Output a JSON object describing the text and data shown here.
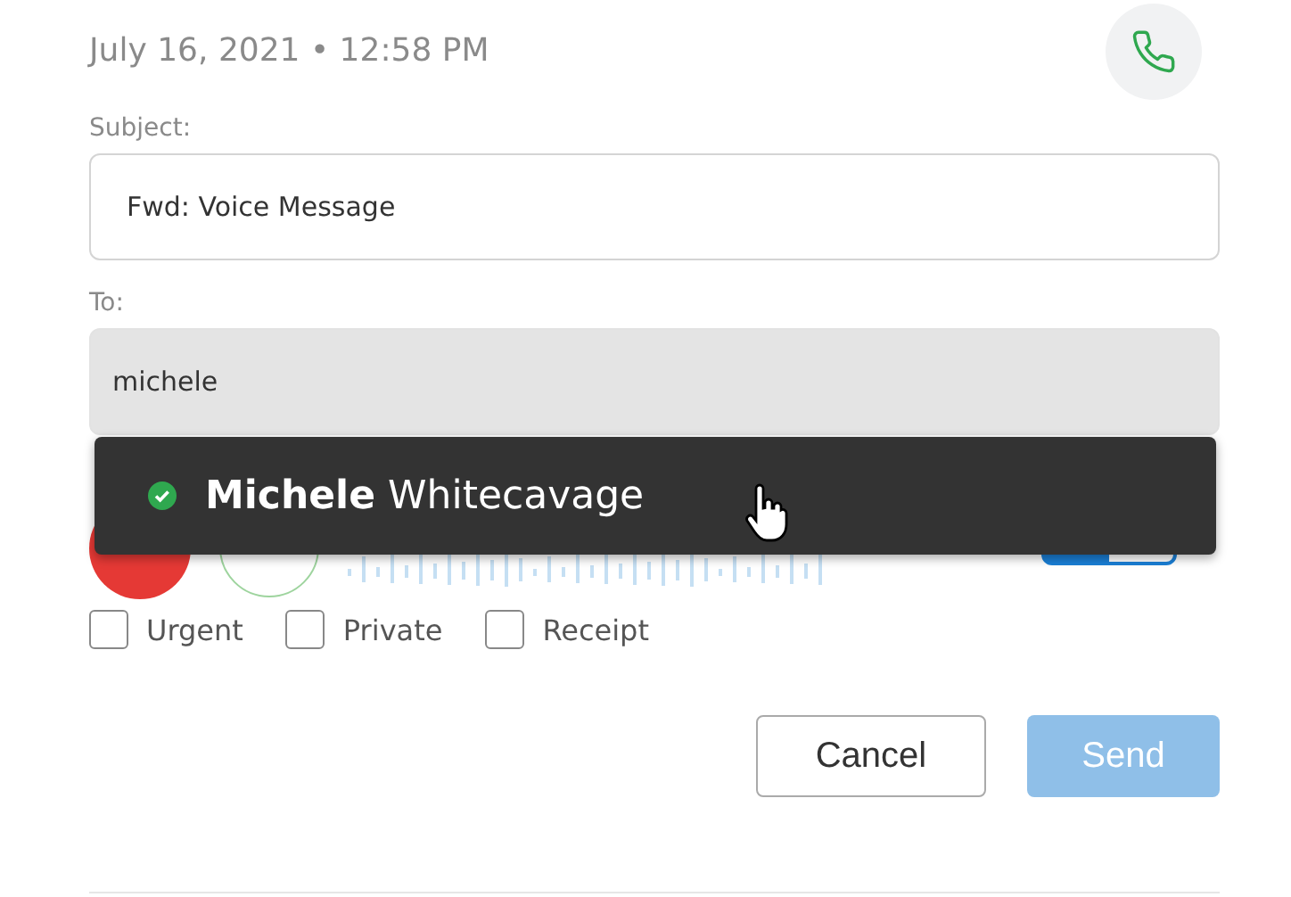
{
  "header": {
    "timestamp": "July 16, 2021 • 12:58 PM"
  },
  "subject": {
    "label": "Subject:",
    "value": "Fwd: Voice Message"
  },
  "to": {
    "label": "To:",
    "value": "michele"
  },
  "suggestions": [
    {
      "name": "**Michele** Whitecavage",
      "online": true
    }
  ],
  "options": [
    {
      "label": "Urgent",
      "checked": false
    },
    {
      "label": "Private",
      "checked": false
    },
    {
      "label": "Receipt",
      "checked": false
    }
  ],
  "buttons": [
    {
      "label": "Cancel",
      "kind": "secondary",
      "disabled": false
    },
    {
      "label": "Send",
      "kind": "primary",
      "disabled": true
    }
  ]
}
